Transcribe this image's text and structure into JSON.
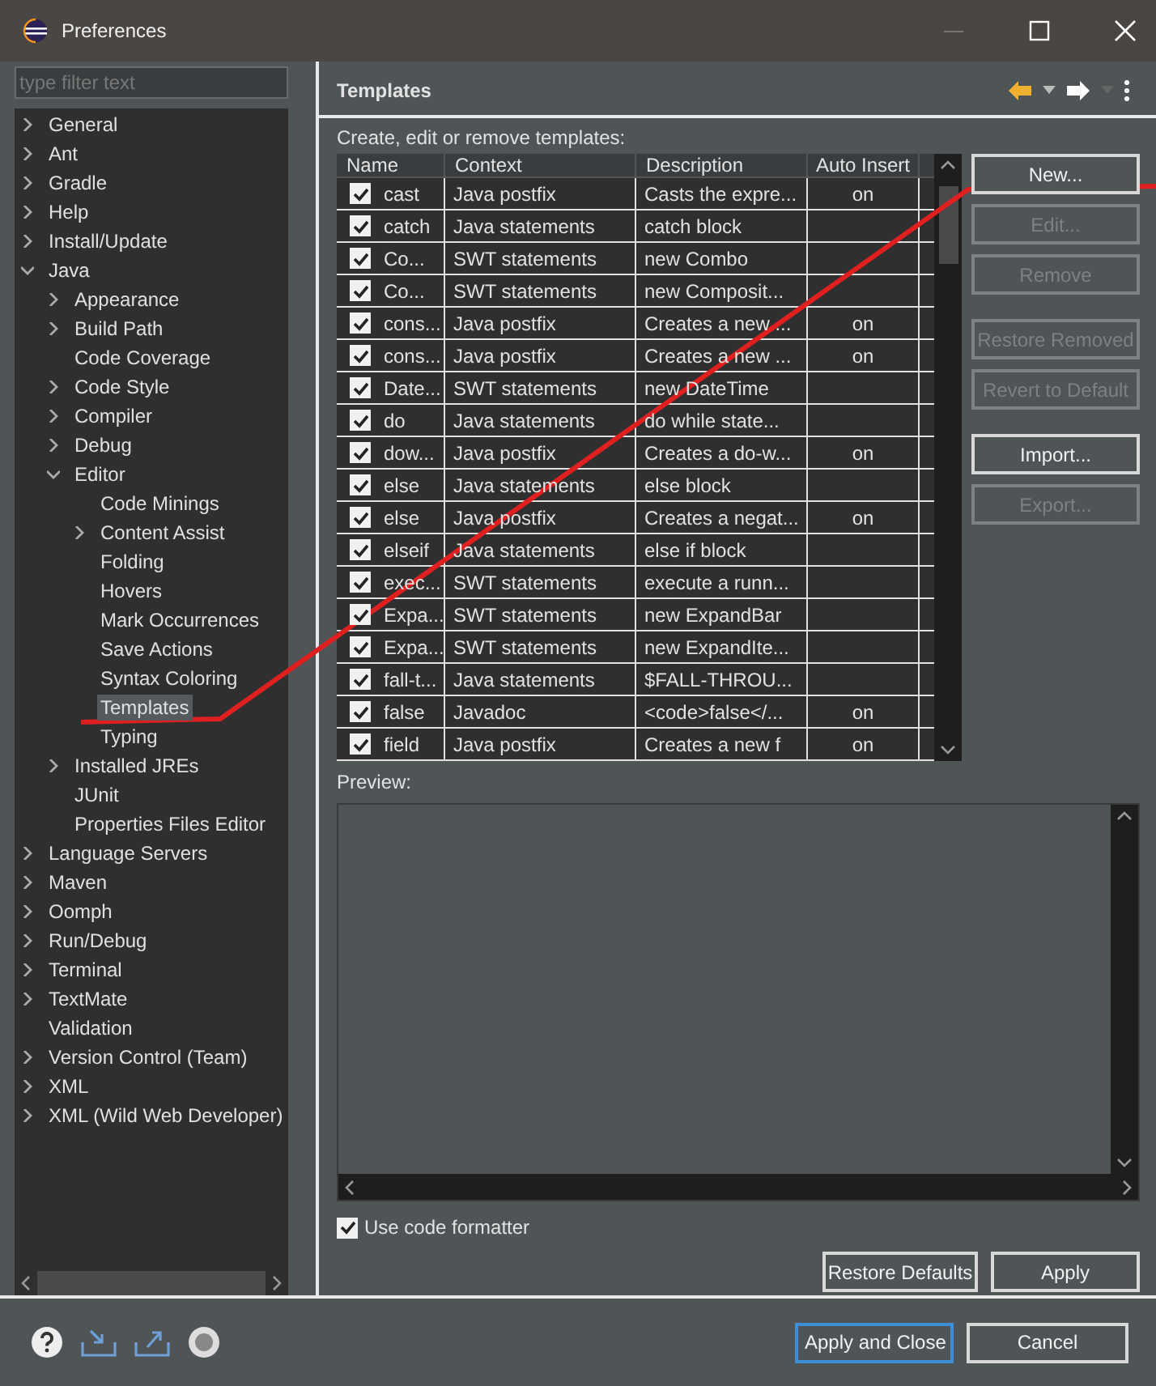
{
  "window": {
    "title": "Preferences"
  },
  "filter": {
    "placeholder": "type filter text"
  },
  "tree": [
    {
      "label": "General",
      "expanded": false,
      "selected": false
    },
    {
      "label": "Ant",
      "expanded": false,
      "selected": false
    },
    {
      "label": "Gradle",
      "expanded": false,
      "selected": false
    },
    {
      "label": "Help",
      "expanded": false,
      "selected": false
    },
    {
      "label": "Install/Update",
      "expanded": false,
      "selected": false
    },
    {
      "label": "Java",
      "expanded": true,
      "selected": false,
      "children": [
        {
          "label": "Appearance",
          "expanded": false,
          "selected": false
        },
        {
          "label": "Build Path",
          "expanded": false,
          "selected": false
        },
        {
          "label": "Code Coverage",
          "selected": false
        },
        {
          "label": "Code Style",
          "expanded": false,
          "selected": false
        },
        {
          "label": "Compiler",
          "expanded": false,
          "selected": false
        },
        {
          "label": "Debug",
          "expanded": false,
          "selected": false
        },
        {
          "label": "Editor",
          "expanded": true,
          "selected": false,
          "children": [
            {
              "label": "Code Minings",
              "selected": false
            },
            {
              "label": "Content Assist",
              "expanded": false,
              "selected": false
            },
            {
              "label": "Folding",
              "selected": false
            },
            {
              "label": "Hovers",
              "selected": false
            },
            {
              "label": "Mark Occurrences",
              "selected": false
            },
            {
              "label": "Save Actions",
              "selected": false
            },
            {
              "label": "Syntax Coloring",
              "selected": false
            },
            {
              "label": "Templates",
              "selected": true
            },
            {
              "label": "Typing",
              "selected": false
            }
          ]
        },
        {
          "label": "Installed JREs",
          "expanded": false,
          "selected": false
        },
        {
          "label": "JUnit",
          "selected": false
        },
        {
          "label": "Properties Files Editor",
          "selected": false
        }
      ]
    },
    {
      "label": "Language Servers",
      "expanded": false,
      "selected": false
    },
    {
      "label": "Maven",
      "expanded": false,
      "selected": false
    },
    {
      "label": "Oomph",
      "expanded": false,
      "selected": false
    },
    {
      "label": "Run/Debug",
      "expanded": false,
      "selected": false
    },
    {
      "label": "Terminal",
      "expanded": false,
      "selected": false
    },
    {
      "label": "TextMate",
      "expanded": false,
      "selected": false
    },
    {
      "label": "Validation",
      "selected": false
    },
    {
      "label": "Version Control (Team)",
      "expanded": false,
      "selected": false
    },
    {
      "label": "XML",
      "expanded": false,
      "selected": false
    },
    {
      "label": "XML (Wild Web Developer)",
      "expanded": false,
      "selected": false
    }
  ],
  "page": {
    "title": "Templates",
    "intro": "Create, edit or remove templates:"
  },
  "table": {
    "columns": [
      "Name",
      "Context",
      "Description",
      "Auto Insert"
    ],
    "rows": [
      {
        "checked": true,
        "name": "cast",
        "context": "Java postfix",
        "description": "Casts the expre...",
        "auto_insert": "on"
      },
      {
        "checked": true,
        "name": "catch",
        "context": "Java statements",
        "description": "catch block"
      },
      {
        "checked": true,
        "name": "Co...",
        "context": "SWT statements",
        "description": "new Combo"
      },
      {
        "checked": true,
        "name": "Co...",
        "context": "SWT statements",
        "description": "new Composit..."
      },
      {
        "checked": true,
        "name": "cons...",
        "context": "Java postfix",
        "description": "Creates a new ...",
        "auto_insert": "on"
      },
      {
        "checked": true,
        "name": "cons...",
        "context": "Java postfix",
        "description": "Creates a new ...",
        "auto_insert": "on"
      },
      {
        "checked": true,
        "name": "Date...",
        "context": "SWT statements",
        "description": "new DateTime"
      },
      {
        "checked": true,
        "name": "do",
        "context": "Java statements",
        "description": "do while state..."
      },
      {
        "checked": true,
        "name": "dow...",
        "context": "Java postfix",
        "description": "Creates a do-w...",
        "auto_insert": "on"
      },
      {
        "checked": true,
        "name": "else",
        "context": "Java statements",
        "description": "else block"
      },
      {
        "checked": true,
        "name": "else",
        "context": "Java postfix",
        "description": "Creates a negat...",
        "auto_insert": "on"
      },
      {
        "checked": true,
        "name": "elseif",
        "context": "Java statements",
        "description": "else if block"
      },
      {
        "checked": true,
        "name": "exec...",
        "context": "SWT statements",
        "description": "execute a runn..."
      },
      {
        "checked": true,
        "name": "Expa...",
        "context": "SWT statements",
        "description": "new ExpandBar"
      },
      {
        "checked": true,
        "name": "Expa...",
        "context": "SWT statements",
        "description": "new ExpandIte..."
      },
      {
        "checked": true,
        "name": "fall-t...",
        "context": "Java statements",
        "description": "$FALL-THROU..."
      },
      {
        "checked": true,
        "name": "false",
        "context": "Javadoc",
        "description": "<code>false</...",
        "auto_insert": "on"
      },
      {
        "checked": true,
        "name": "field",
        "context": "Java postfix",
        "description": "Creates a new f",
        "auto_insert": "on"
      }
    ]
  },
  "side_button_groups": [
    [
      {
        "label": "New...",
        "disabled": false
      },
      {
        "label": "Edit...",
        "disabled": true
      },
      {
        "label": "Remove",
        "disabled": true
      }
    ],
    [
      {
        "label": "Restore Removed",
        "disabled": true
      },
      {
        "label": "Revert to Default",
        "disabled": true
      }
    ],
    [
      {
        "label": "Import...",
        "disabled": false
      },
      {
        "label": "Export...",
        "disabled": true
      }
    ]
  ],
  "preview": {
    "label": "Preview:"
  },
  "formatter": {
    "label": "Use code formatter",
    "checked": true
  },
  "page_buttons": [
    "Restore Defaults",
    "Apply"
  ],
  "dialog_buttons": [
    {
      "label": "Apply and Close",
      "default": true
    },
    {
      "label": "Cancel",
      "default": false
    }
  ]
}
